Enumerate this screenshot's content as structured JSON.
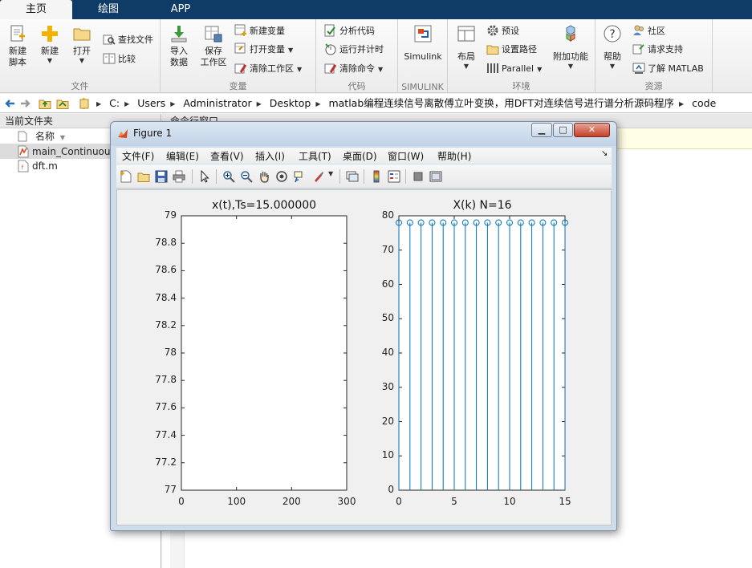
{
  "tabs": [
    {
      "label": "主页",
      "active": true
    },
    {
      "label": "绘图",
      "active": false
    },
    {
      "label": "APP",
      "active": false
    }
  ],
  "ribbon": {
    "file": {
      "label": "文件",
      "new_script": [
        "新建",
        "脚本"
      ],
      "new": "新建",
      "open": "打开",
      "find_files": "查找文件",
      "compare": "比较"
    },
    "variable": {
      "label": "变量",
      "import": [
        "导入",
        "数据"
      ],
      "save": [
        "保存",
        "工作区"
      ],
      "new_variable": "新建变量",
      "open_variable": "打开变量",
      "clear_workspace": "清除工作区"
    },
    "code": {
      "label": "代码",
      "analyze": "分析代码",
      "run_time": "运行并计时",
      "clear_commands": "清除命令"
    },
    "simulink": {
      "label": "SIMULINK",
      "button": "Simulink"
    },
    "environment": {
      "label": "环境",
      "layout": "布局",
      "preferences": "预设",
      "set_path": "设置路径",
      "parallel": "Parallel",
      "addons": "附加功能"
    },
    "resources": {
      "label": "资源",
      "help": "帮助",
      "community": "社区",
      "request_support": "请求支持",
      "learn_matlab": "了解 MATLAB"
    }
  },
  "address": {
    "crumbs": [
      "C:",
      "Users",
      "Administrator",
      "Desktop",
      "matlab编程连续信号离散傅立叶变换，用DFT对连续信号进行谱分析源码程序",
      "code"
    ]
  },
  "current_folder": {
    "title": "当前文件夹",
    "column": "名称",
    "files": [
      {
        "name": "main_Continuous",
        "selected": true
      },
      {
        "name": "dft.m",
        "selected": false
      }
    ]
  },
  "command_window": {
    "title": "命令行窗口"
  },
  "figure": {
    "title": "Figure 1",
    "menus": [
      "文件(F)",
      "编辑(E)",
      "查看(V)",
      "插入(I)",
      "工具(T)",
      "桌面(D)",
      "窗口(W)",
      "帮助(H)"
    ]
  },
  "chart_data": [
    {
      "type": "line",
      "title": "x(t),Ts=15.000000",
      "xlim": [
        0,
        300
      ],
      "ylim": [
        77,
        79
      ],
      "xticks": [
        0,
        100,
        200,
        300
      ],
      "yticks": [
        77,
        77.2,
        77.4,
        77.6,
        77.8,
        78,
        78.2,
        78.4,
        78.6,
        78.8,
        79
      ],
      "x": [],
      "y": [],
      "grid": false,
      "color": "#0072bd"
    },
    {
      "type": "stem",
      "title": "X(k) N=16",
      "xlim": [
        0,
        15
      ],
      "ylim": [
        0,
        80
      ],
      "xticks": [
        0,
        5,
        10,
        15
      ],
      "yticks": [
        0,
        10,
        20,
        30,
        40,
        50,
        60,
        70,
        80
      ],
      "x": [
        0,
        1,
        2,
        3,
        4,
        5,
        6,
        7,
        8,
        9,
        10,
        11,
        12,
        13,
        14,
        15
      ],
      "y": [
        78,
        78,
        78,
        78,
        78,
        78,
        78,
        78,
        78,
        78,
        78,
        78,
        78,
        78,
        78,
        78
      ],
      "grid": false,
      "color": "#0072bd"
    }
  ]
}
